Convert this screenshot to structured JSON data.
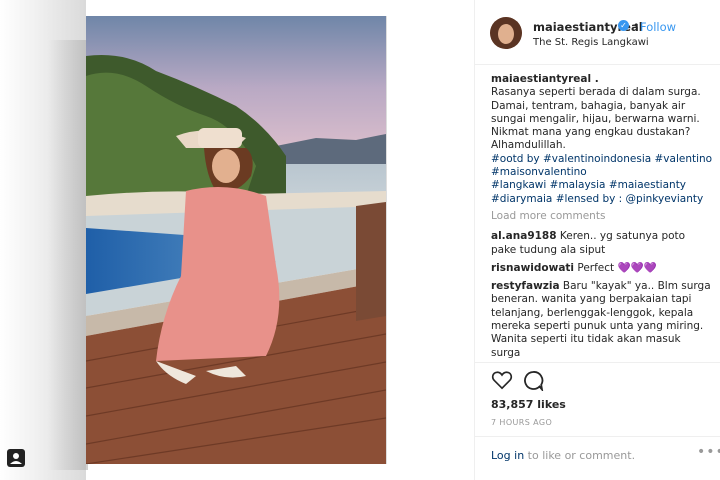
{
  "post": {
    "username": "maiaestiantyreal",
    "follow_label": "Follow",
    "separator": "•",
    "location": "The St. Regis Langkawi",
    "caption_user": "maiaestiantyreal .",
    "caption_lines": [
      "Rasanya seperti berada di dalam surga.",
      "Damai, tentram, bahagia, banyak air sungai mengalir, hijau, berwarna warni. Nikmat mana yang engkau dustakan?",
      "Alhamdulillah."
    ],
    "hashtags_1": "#ootd by #valentinoindonesia #valentino #maisonvalentino",
    "hashtags_2": "#langkawi #malaysia #maiaestianty #diarymaia #lensed by : @pinkyevianty",
    "load_more": "Load more comments",
    "comments": [
      {
        "user": "al.ana9188",
        "text": "Keren.. yg satunya poto pake tudung ala siput"
      },
      {
        "user": "risnawidowati",
        "text": "Perfect",
        "emoji": "💜💜💜"
      },
      {
        "user": "restyfawzia",
        "text": "Baru \"kayak\" ya.. Blm surga beneran. wanita yang berpakaian tapi telanjang, berlenggak-lenggok, kepala mereka seperti punuk unta yang miring. Wanita seperti itu tidak akan masuk surga"
      }
    ],
    "likes": "83,857 likes",
    "time": "7 HOURS AGO",
    "login_link": "Log in",
    "login_rest": " to like or comment.",
    "more_label": "•••"
  },
  "icons": {
    "verified": "verified-badge-icon",
    "like": "heart-icon",
    "comment": "comment-bubble-icon",
    "more": "more-options-icon",
    "corner": "portrait-icon"
  },
  "colors": {
    "link": "#3897f0",
    "hashtag": "#003569",
    "muted": "#999999",
    "text": "#262626"
  }
}
